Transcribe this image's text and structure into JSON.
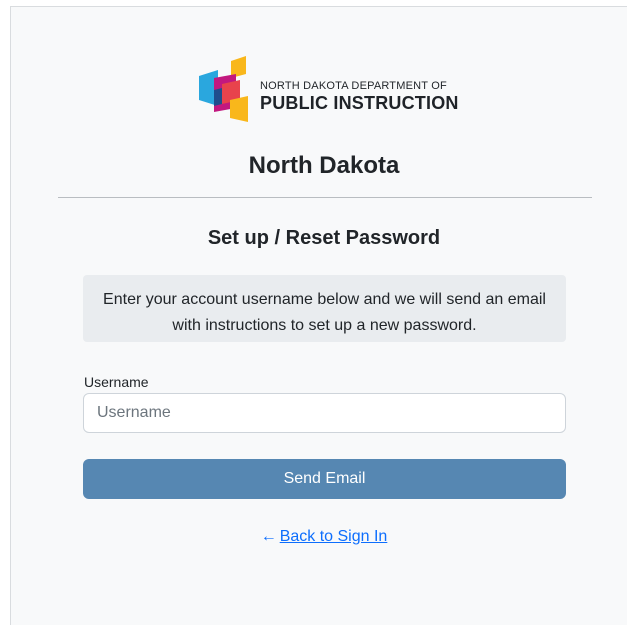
{
  "logo": {
    "line1": "NORTH DAKOTA DEPARTMENT OF",
    "line2": "PUBLIC INSTRUCTION",
    "colors": {
      "blue": "#2aa7de",
      "yellow": "#f9b71b",
      "magenta": "#c2187f",
      "red": "#e8434c",
      "navy": "#1f4e8c"
    }
  },
  "header": {
    "state_name": "North Dakota"
  },
  "form": {
    "title": "Set up / Reset Password",
    "info_text": "Enter your account username below and we will send an email with instructions to set up a new password.",
    "username_label": "Username",
    "username_placeholder": "Username",
    "username_value": "",
    "submit_label": "Send Email"
  },
  "footer": {
    "back_arrow": "←",
    "back_label": "Back to Sign In"
  },
  "colors": {
    "primary_button": "#5687b2",
    "link": "#0d6efd",
    "info_box_bg": "#e9ecef",
    "card_bg": "#f8f9fa"
  }
}
